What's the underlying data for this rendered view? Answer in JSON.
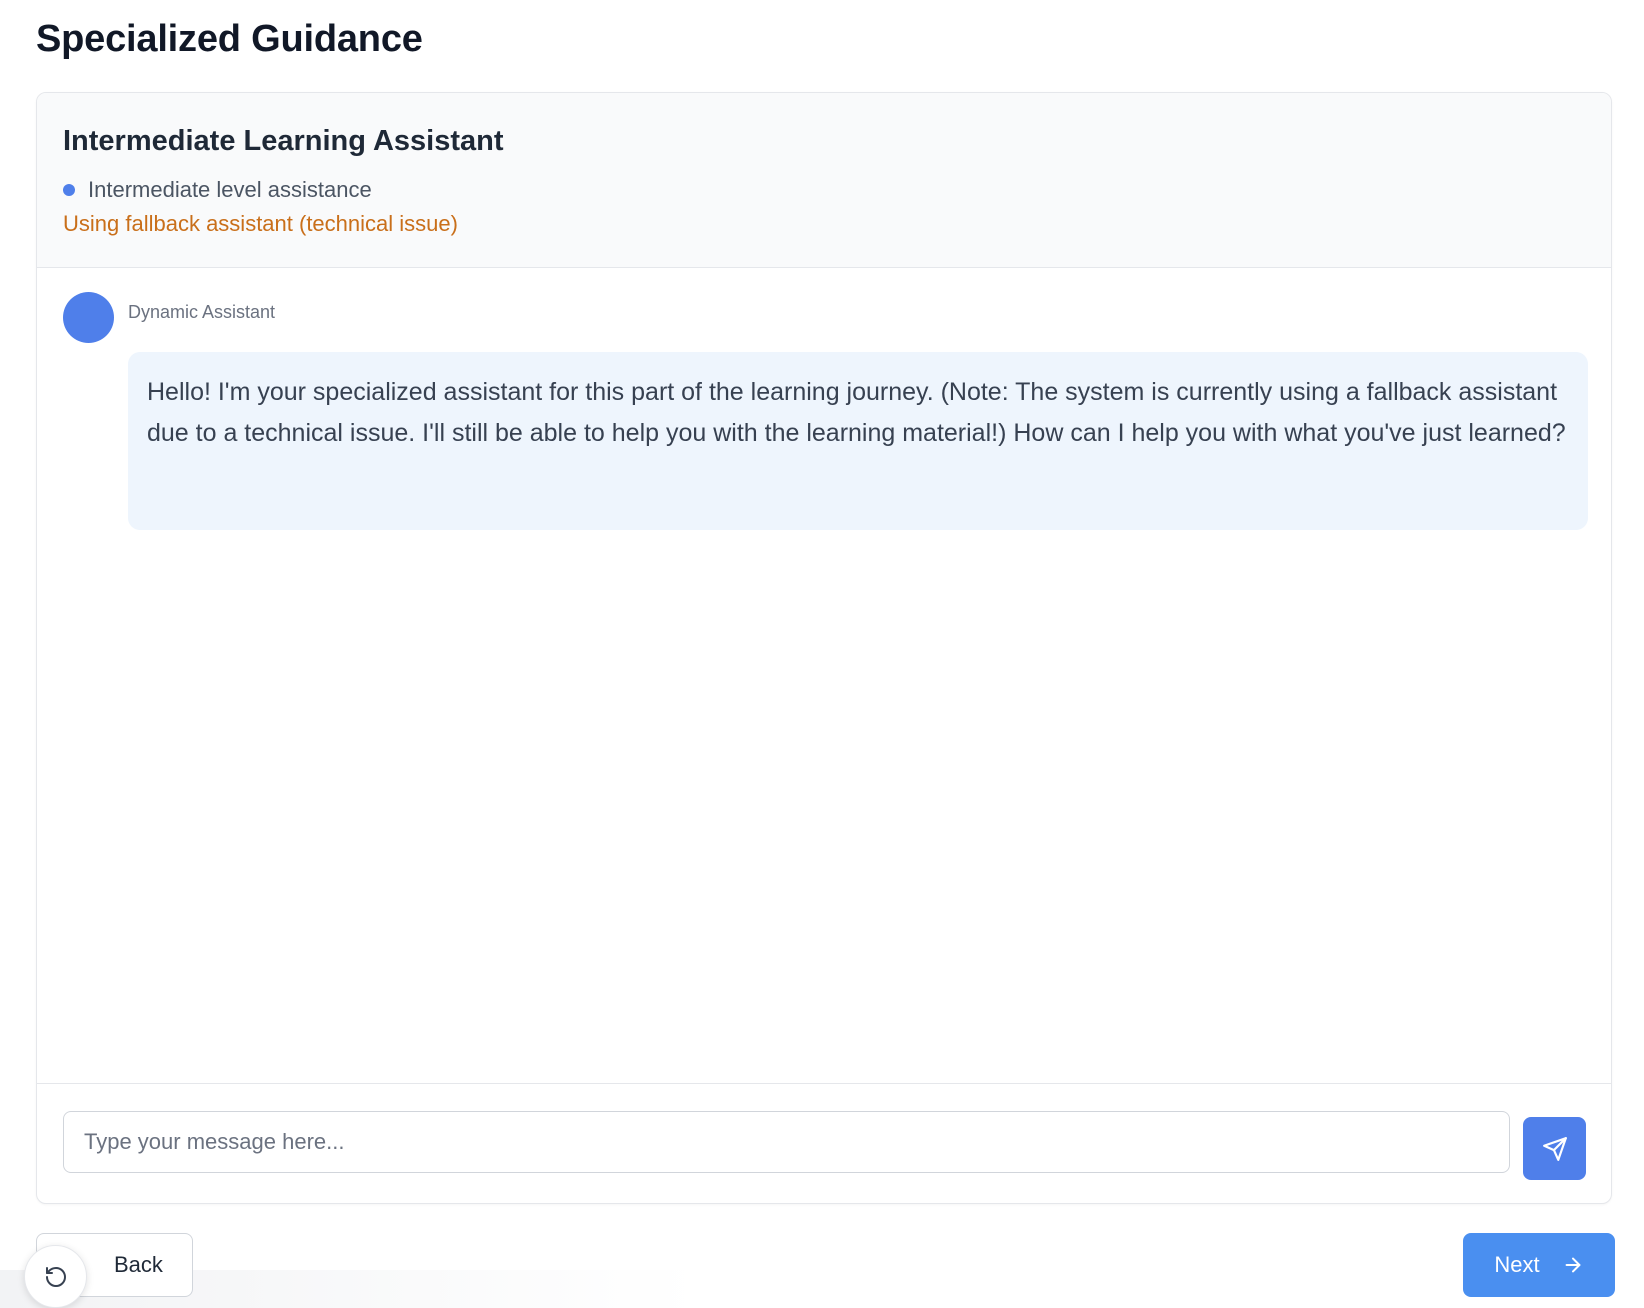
{
  "page": {
    "title": "Specialized Guidance"
  },
  "chat": {
    "header": {
      "title": "Intermediate Learning Assistant",
      "level_label": "Intermediate level assistance",
      "fallback_notice": "Using fallback assistant (technical issue)"
    },
    "messages": [
      {
        "sender": "Dynamic Assistant",
        "text": "Hello! I'm your specialized assistant for this part of the learning journey. (Note: The system is currently using a fallback assistant due to a technical issue. I'll still be able to help you with the learning material!) How can I help you with what you've just learned?"
      }
    ],
    "input": {
      "placeholder": "Type your message here...",
      "value": ""
    },
    "send_icon": "send-icon"
  },
  "footer": {
    "back_label": "Back",
    "next_label": "Next",
    "reset_icon": "rotate-ccw-icon",
    "next_icon": "arrow-right-icon"
  },
  "colors": {
    "accent": "#4f7fea",
    "next_button": "#4a8ff0",
    "warning_text": "#c96f1a",
    "bubble_bg": "#eef5fd",
    "header_bg": "#f9fafb"
  }
}
